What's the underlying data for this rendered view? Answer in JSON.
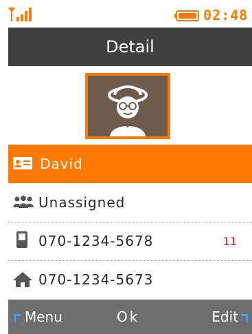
{
  "status": {
    "time": "02:48",
    "signal_icon": "signal-strength-icon",
    "battery_icon": "battery-icon",
    "accent_color": "#ff7a00"
  },
  "header": {
    "title": "Detail"
  },
  "contact": {
    "avatar_icon": "person-avatar-icon",
    "name": "David",
    "group": "Unassigned",
    "mobile": "070-1234-5678",
    "mobile_badge": "11",
    "home": "070-1234-5673"
  },
  "softkeys": {
    "left": "Menu",
    "center": "Ok",
    "right": "Edit"
  },
  "colors": {
    "title_bar": "#404040",
    "highlight": "#ff7a00",
    "softkey_bar": "#6e6e6e",
    "badge": "#c21b1b"
  }
}
